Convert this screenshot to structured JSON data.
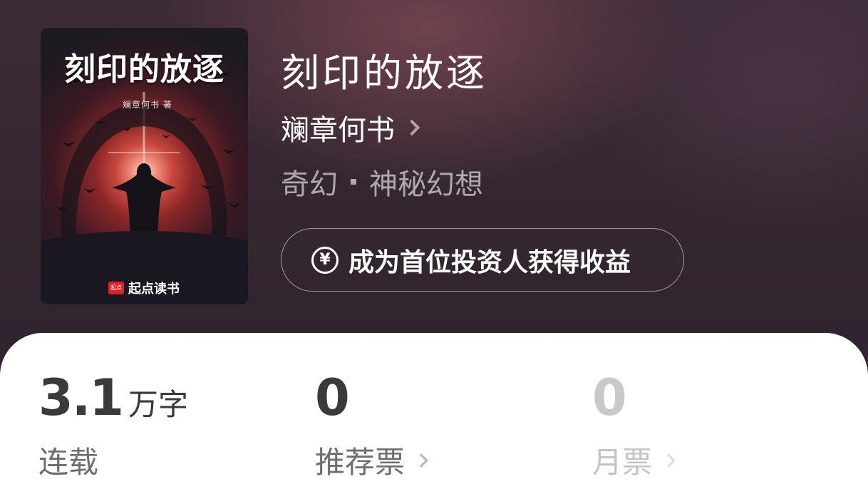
{
  "colors": {
    "header_bg": "#33262f",
    "panel_bg": "#ffffff",
    "text_primary": "#3a3a3a",
    "text_secondary": "#6e6e6e",
    "text_muted": "#c9c9c9",
    "publisher_red": "#d9232d"
  },
  "cover": {
    "title": "刻印的放逐",
    "author": "斓章何书 著",
    "publisher_logo": "起点",
    "publisher": "起点读书"
  },
  "book": {
    "title": "刻印的放逐",
    "author": "斓章何书",
    "category": "奇幻",
    "subcategory": "神秘幻想"
  },
  "invest_button": {
    "icon": "yuan-icon",
    "icon_glyph": "¥",
    "label": "成为首位投资人获得收益"
  },
  "stats": {
    "words": {
      "value": "3.1",
      "unit": "万字",
      "label": "连载"
    },
    "recommend": {
      "value": "0",
      "label": "推荐票"
    },
    "monthly": {
      "value": "0",
      "label": "月票"
    }
  }
}
